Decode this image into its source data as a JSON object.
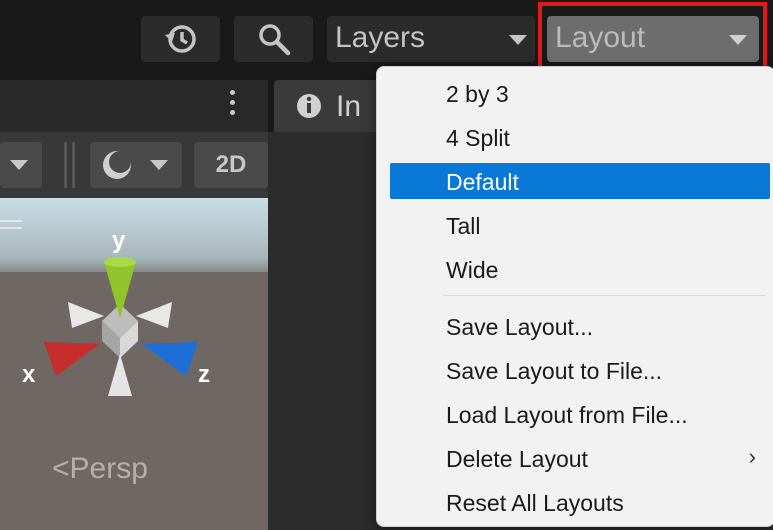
{
  "toolbar": {
    "history_icon": "history-icon",
    "search_icon": "search-icon",
    "layers_label": "Layers",
    "layout_label": "Layout"
  },
  "scene": {
    "mode_2d_label": "2D",
    "axis_x": "x",
    "axis_y": "y",
    "axis_z": "z",
    "projection_label": "Persp"
  },
  "inspector": {
    "tab_label": "In"
  },
  "layout_menu": {
    "items": [
      {
        "label": "2 by 3"
      },
      {
        "label": "4 Split"
      },
      {
        "label": "Default",
        "selected": true
      },
      {
        "label": "Tall"
      },
      {
        "label": "Wide"
      },
      {
        "label": "Save Layout..."
      },
      {
        "label": "Save Layout to File..."
      },
      {
        "label": "Load Layout from File..."
      },
      {
        "label": "Delete Layout",
        "submenu": true
      },
      {
        "label": "Reset All Layouts"
      }
    ],
    "submenu_icon": "chevron-right-icon"
  },
  "colors": {
    "highlight": "#e01919",
    "selection": "#0a78d7",
    "axis_x": "#c62d2d",
    "axis_y": "#8fc42b",
    "axis_z": "#1f6fd8"
  }
}
